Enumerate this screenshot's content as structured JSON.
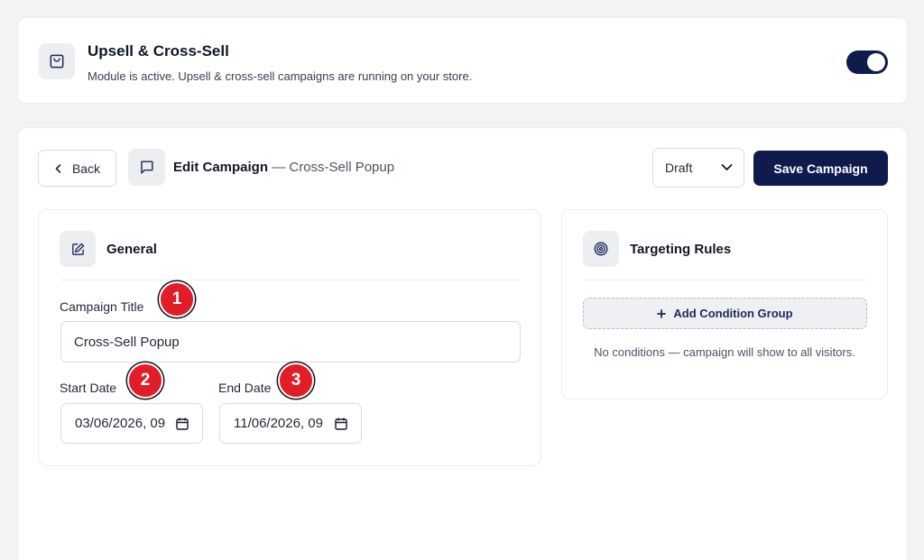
{
  "module": {
    "title": "Upsell & Cross-Sell",
    "description": "Module is active. Upsell & cross-sell campaigns are running on your store.",
    "icon": "shopping-bag-icon",
    "toggle_on": true
  },
  "header": {
    "back_label": "Back",
    "edit_label": "Edit Campaign",
    "separator": " — ",
    "campaign_name": "Cross-Sell Popup",
    "status": "Draft",
    "save_label": "Save Campaign"
  },
  "general": {
    "title": "General",
    "campaign_title_label": "Campaign Title",
    "campaign_title_value": "Cross-Sell Popup",
    "start_date_label": "Start Date",
    "start_date_value": "03/06/2026, 09",
    "end_date_label": "End Date",
    "end_date_value": "11/06/2026, 09"
  },
  "targeting": {
    "title": "Targeting Rules",
    "add_group_label": "Add Condition Group",
    "empty_message": "No conditions — campaign will show to all visitors."
  },
  "annotations": [
    "1",
    "2",
    "3"
  ],
  "colors": {
    "accent": "#0f1b4d",
    "badge": "#e11d2a",
    "background": "#f2f3f5"
  }
}
